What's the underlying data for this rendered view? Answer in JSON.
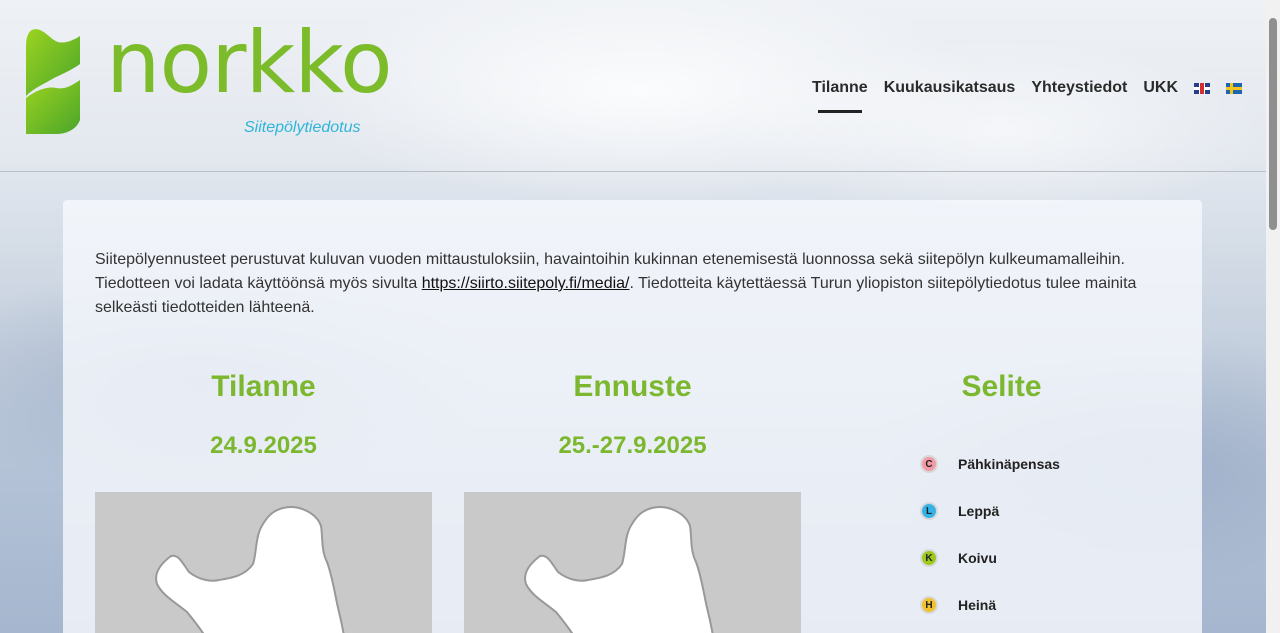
{
  "brand": {
    "name": "norkko",
    "tagline": "Siitepölytiedotus",
    "green": "#7cbb2a",
    "blue": "#2fb5d8"
  },
  "nav": {
    "items": [
      {
        "label": "Tilanne",
        "active": true
      },
      {
        "label": "Kuukausikatsaus",
        "active": false
      },
      {
        "label": "Yhteystiedot",
        "active": false
      },
      {
        "label": "UKK",
        "active": false
      }
    ],
    "flags": [
      "uk-flag-icon",
      "sweden-flag-icon"
    ]
  },
  "intro": {
    "text_before_link": "Siitepölyennusteet perustuvat kuluvan vuoden mittaustuloksiin, havaintoihin kukinnan etenemisestä luonnossa sekä siitepölyn kulkeumamalleihin. Tiedotteen voi ladata käyttöönsä myös sivulta ",
    "link": "https://siirto.siitepoly.fi/media/",
    "text_after_link": ". Tiedotteita käytettäessä Turun yliopiston siitepölytiedotus tulee mainita selkeästi tiedotteiden lähteenä."
  },
  "columns": {
    "current": {
      "title": "Tilanne",
      "date": "24.9.2025"
    },
    "forecast": {
      "title": "Ennuste",
      "date": "25.-27.9.2025"
    },
    "legend": {
      "title": "Selite"
    }
  },
  "legend": [
    {
      "letter": "C",
      "label": "Pähkinäpensas",
      "color": "#f39aa6"
    },
    {
      "letter": "L",
      "label": "Leppä",
      "color": "#35b3e6"
    },
    {
      "letter": "K",
      "label": "Koivu",
      "color": "#9dc81e"
    },
    {
      "letter": "H",
      "label": "Heinä",
      "color": "#f2c12e"
    }
  ]
}
